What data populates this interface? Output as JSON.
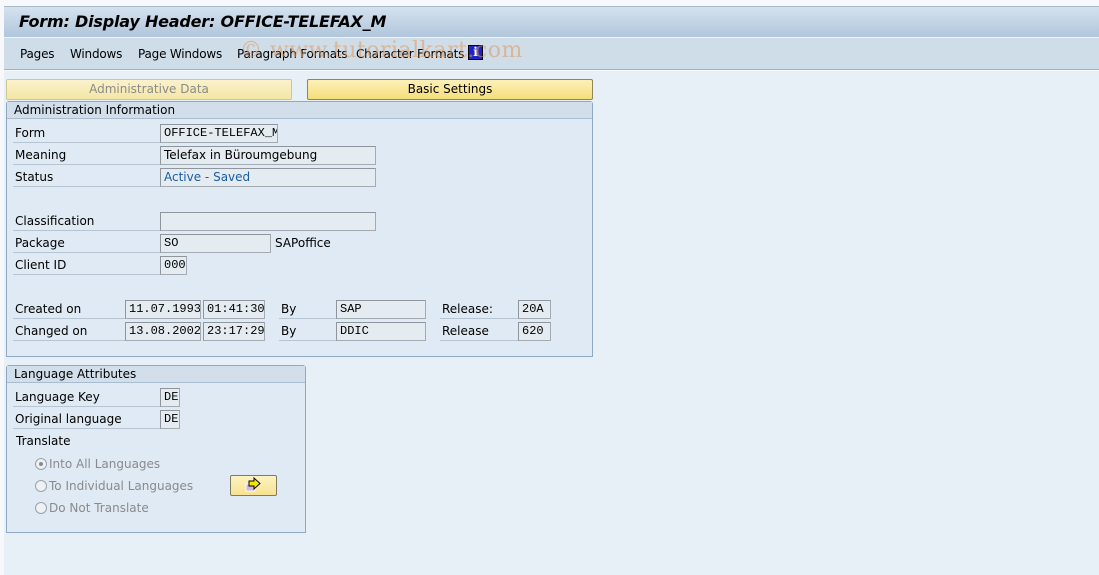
{
  "window": {
    "title": "Form: Display Header: OFFICE-TELEFAX_M"
  },
  "menu": {
    "items": [
      {
        "label": "Pages"
      },
      {
        "label": "Windows"
      },
      {
        "label": "Page Windows"
      },
      {
        "label": "Paragraph Formats"
      },
      {
        "label": "Character Formats"
      }
    ],
    "info_icon": "i"
  },
  "watermark": "© www.tutorialkart.com",
  "tabs": {
    "administrative_data": "Administrative Data",
    "basic_settings": "Basic Settings"
  },
  "admin_info": {
    "title": "Administration Information",
    "form_label": "Form",
    "form_value": "OFFICE-TELEFAX_M",
    "meaning_label": "Meaning",
    "meaning_value": "Telefax in Büroumgebung",
    "status_label": "Status",
    "status_value": "Active - Saved",
    "classification_label": "Classification",
    "classification_value": "",
    "package_label": "Package",
    "package_value": "SO",
    "package_desc": "SAPoffice",
    "client_label": "Client ID",
    "client_value": "000",
    "created_label": "Created on",
    "created_date": "11.07.1993",
    "created_time": "01:41:30",
    "created_by_label": "By",
    "created_by": "SAP",
    "created_release_label": "Release:",
    "created_release": "20A",
    "changed_label": "Changed on",
    "changed_date": "13.08.2002",
    "changed_time": "23:17:29",
    "changed_by_label": "By",
    "changed_by": "DDIC",
    "changed_release_label": "Release",
    "changed_release": "620"
  },
  "language": {
    "title": "Language Attributes",
    "key_label": "Language Key",
    "key_value": "DE",
    "original_label": "Original language",
    "original_value": "DE",
    "translate_label": "Translate",
    "options": [
      {
        "label": "Into All Languages",
        "selected": true
      },
      {
        "label": "To Individual Languages",
        "selected": false
      },
      {
        "label": "Do Not Translate",
        "selected": false
      }
    ],
    "languages_button_icon": "arrow-right"
  }
}
